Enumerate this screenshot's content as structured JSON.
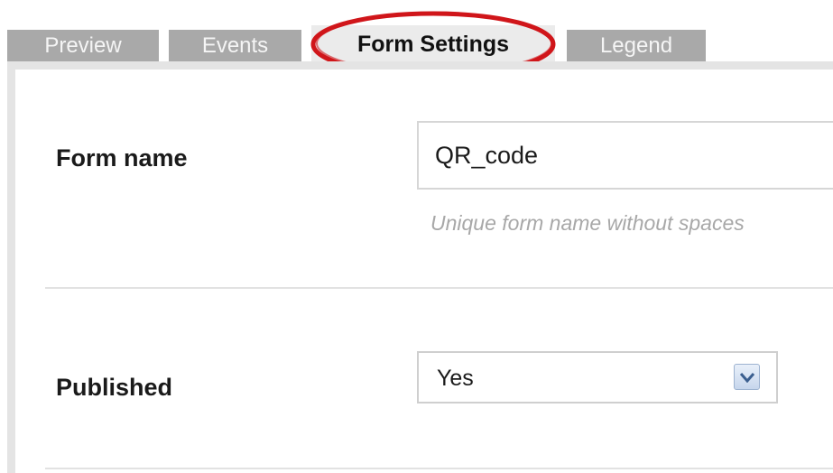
{
  "tabs": [
    {
      "label": "Preview"
    },
    {
      "label": "Events"
    },
    {
      "label": "Form Settings"
    },
    {
      "label": "Legend"
    }
  ],
  "active_tab": "Form Settings",
  "form_name": {
    "label": "Form name",
    "value": "QR_code",
    "help": "Unique form name without spaces"
  },
  "published": {
    "label": "Published",
    "value": "Yes"
  },
  "colors": {
    "tab_inactive": "#a9a9a9",
    "tab_active": "#ebebeb",
    "highlight": "#d0161a",
    "help_text": "#a8a8a8"
  },
  "icons": {
    "select_arrow": "chevron-down-icon"
  }
}
